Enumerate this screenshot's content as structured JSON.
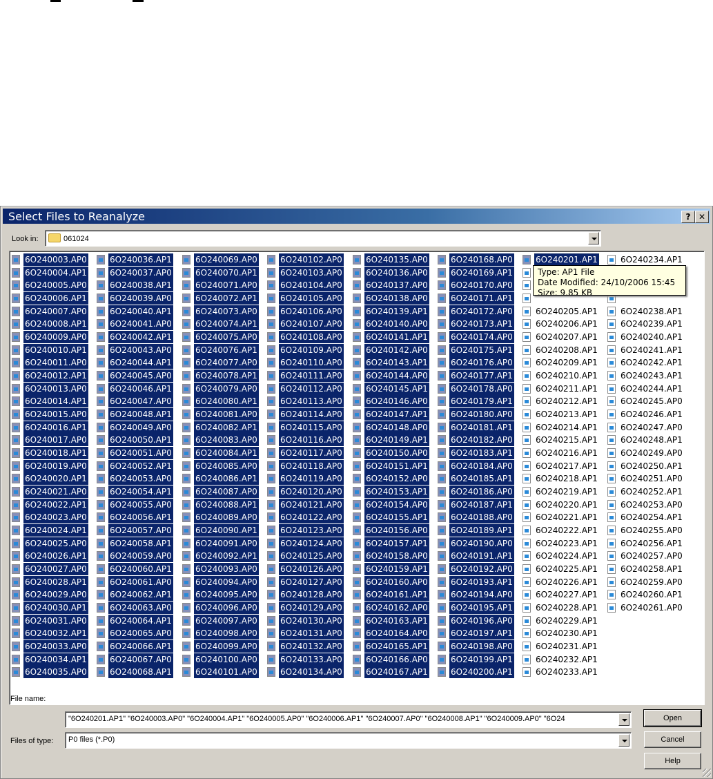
{
  "dialog": {
    "title": "Select Files to Reanalyze",
    "help_button": "?",
    "close_button": "✕",
    "look_in_label": "Look in:",
    "look_in_value": "061024",
    "file_name_label": "File name:",
    "file_name_value": "\"6O240201.AP1\" \"6O240003.AP0\" \"6O240004.AP1\" \"6O240005.AP0\" \"6O240006.AP1\" \"6O240007.AP0\" \"6O240008.AP1\" \"6O240009.AP0\" \"6O24",
    "files_of_type_label": "Files of type:",
    "files_of_type_value": "P0 files   (*.P0)",
    "open_button": "Open",
    "cancel_button": "Cancel",
    "help_text_button": "Help"
  },
  "tooltip": {
    "type": "Type: AP1 File",
    "modified": "Date Modified: 24/10/2006 15:45",
    "size": "Size: 9.85 KB"
  },
  "file_list": {
    "focused": "6O240201.AP1",
    "selected_columns": [
      0,
      1,
      2,
      3,
      4,
      5
    ],
    "columns": [
      [
        "6O240003.AP0",
        "6O240004.AP1",
        "6O240005.AP0",
        "6O240006.AP1",
        "6O240007.AP0",
        "6O240008.AP1",
        "6O240009.AP0",
        "6O240010.AP1",
        "6O240011.AP0",
        "6O240012.AP1",
        "6O240013.AP0",
        "6O240014.AP1",
        "6O240015.AP0",
        "6O240016.AP1",
        "6O240017.AP0",
        "6O240018.AP1",
        "6O240019.AP0",
        "6O240020.AP1",
        "6O240021.AP0",
        "6O240022.AP1",
        "6O240023.AP0",
        "6O240024.AP1",
        "6O240025.AP0",
        "6O240026.AP1",
        "6O240027.AP0",
        "6O240028.AP1",
        "6O240029.AP0",
        "6O240030.AP1",
        "6O240031.AP0",
        "6O240032.AP1",
        "6O240033.AP0",
        "6O240034.AP1",
        "6O240035.AP0"
      ],
      [
        "6O240036.AP1",
        "6O240037.AP0",
        "6O240038.AP1",
        "6O240039.AP0",
        "6O240040.AP1",
        "6O240041.AP0",
        "6O240042.AP1",
        "6O240043.AP0",
        "6O240044.AP1",
        "6O240045.AP0",
        "6O240046.AP1",
        "6O240047.AP0",
        "6O240048.AP1",
        "6O240049.AP0",
        "6O240050.AP1",
        "6O240051.AP0",
        "6O240052.AP1",
        "6O240053.AP0",
        "6O240054.AP1",
        "6O240055.AP0",
        "6O240056.AP1",
        "6O240057.AP0",
        "6O240058.AP1",
        "6O240059.AP0",
        "6O240060.AP1",
        "6O240061.AP0",
        "6O240062.AP1",
        "6O240063.AP0",
        "6O240064.AP1",
        "6O240065.AP0",
        "6O240066.AP1",
        "6O240067.AP0",
        "6O240068.AP1"
      ],
      [
        "6O240069.AP0",
        "6O240070.AP1",
        "6O240071.AP0",
        "6O240072.AP1",
        "6O240073.AP0",
        "6O240074.AP1",
        "6O240075.AP0",
        "6O240076.AP1",
        "6O240077.AP0",
        "6O240078.AP1",
        "6O240079.AP0",
        "6O240080.AP1",
        "6O240081.AP0",
        "6O240082.AP1",
        "6O240083.AP0",
        "6O240084.AP1",
        "6O240085.AP0",
        "6O240086.AP1",
        "6O240087.AP0",
        "6O240088.AP1",
        "6O240089.AP0",
        "6O240090.AP1",
        "6O240091.AP0",
        "6O240092.AP1",
        "6O240093.AP0",
        "6O240094.AP0",
        "6O240095.AP0",
        "6O240096.AP0",
        "6O240097.AP0",
        "6O240098.AP0",
        "6O240099.AP0",
        "6O240100.AP0",
        "6O240101.AP0"
      ],
      [
        "6O240102.AP0",
        "6O240103.AP0",
        "6O240104.AP0",
        "6O240105.AP0",
        "6O240106.AP0",
        "6O240107.AP0",
        "6O240108.AP0",
        "6O240109.AP0",
        "6O240110.AP0",
        "6O240111.AP0",
        "6O240112.AP0",
        "6O240113.AP0",
        "6O240114.AP0",
        "6O240115.AP0",
        "6O240116.AP0",
        "6O240117.AP0",
        "6O240118.AP0",
        "6O240119.AP0",
        "6O240120.AP0",
        "6O240121.AP0",
        "6O240122.AP0",
        "6O240123.AP0",
        "6O240124.AP0",
        "6O240125.AP0",
        "6O240126.AP0",
        "6O240127.AP0",
        "6O240128.AP0",
        "6O240129.AP0",
        "6O240130.AP0",
        "6O240131.AP0",
        "6O240132.AP0",
        "6O240133.AP0",
        "6O240134.AP0"
      ],
      [
        "6O240135.AP0",
        "6O240136.AP0",
        "6O240137.AP0",
        "6O240138.AP0",
        "6O240139.AP1",
        "6O240140.AP0",
        "6O240141.AP1",
        "6O240142.AP0",
        "6O240143.AP1",
        "6O240144.AP0",
        "6O240145.AP1",
        "6O240146.AP0",
        "6O240147.AP1",
        "6O240148.AP0",
        "6O240149.AP1",
        "6O240150.AP0",
        "6O240151.AP1",
        "6O240152.AP0",
        "6O240153.AP1",
        "6O240154.AP0",
        "6O240155.AP1",
        "6O240156.AP0",
        "6O240157.AP1",
        "6O240158.AP0",
        "6O240159.AP1",
        "6O240160.AP0",
        "6O240161.AP1",
        "6O240162.AP0",
        "6O240163.AP1",
        "6O240164.AP0",
        "6O240165.AP1",
        "6O240166.AP0",
        "6O240167.AP1"
      ],
      [
        "6O240168.AP0",
        "6O240169.AP1",
        "6O240170.AP0",
        "6O240171.AP1",
        "6O240172.AP0",
        "6O240173.AP1",
        "6O240174.AP0",
        "6O240175.AP1",
        "6O240176.AP0",
        "6O240177.AP1",
        "6O240178.AP0",
        "6O240179.AP1",
        "6O240180.AP0",
        "6O240181.AP1",
        "6O240182.AP0",
        "6O240183.AP1",
        "6O240184.AP0",
        "6O240185.AP1",
        "6O240186.AP0",
        "6O240187.AP1",
        "6O240188.AP0",
        "6O240189.AP1",
        "6O240190.AP0",
        "6O240191.AP1",
        "6O240192.AP0",
        "6O240193.AP1",
        "6O240194.AP0",
        "6O240195.AP1",
        "6O240196.AP0",
        "6O240197.AP1",
        "6O240198.AP0",
        "6O240199.AP1",
        "6O240200.AP1"
      ],
      [
        "6O240201.AP1",
        "",
        "",
        "",
        "6O240205.AP1",
        "6O240206.AP1",
        "6O240207.AP1",
        "6O240208.AP1",
        "6O240209.AP1",
        "6O240210.AP1",
        "6O240211.AP1",
        "6O240212.AP1",
        "6O240213.AP1",
        "6O240214.AP1",
        "6O240215.AP1",
        "6O240216.AP1",
        "6O240217.AP1",
        "6O240218.AP1",
        "6O240219.AP1",
        "6O240220.AP1",
        "6O240221.AP1",
        "6O240222.AP1",
        "6O240223.AP1",
        "6O240224.AP1",
        "6O240225.AP1",
        "6O240226.AP1",
        "6O240227.AP1",
        "6O240228.AP1",
        "6O240229.AP1",
        "6O240230.AP1",
        "6O240231.AP1",
        "6O240232.AP1",
        "6O240233.AP1"
      ],
      [
        "6O240234.AP1",
        "",
        "",
        "",
        "6O240238.AP1",
        "6O240239.AP1",
        "6O240240.AP1",
        "6O240241.AP1",
        "6O240242.AP1",
        "6O240243.AP1",
        "6O240244.AP1",
        "6O240245.AP0",
        "6O240246.AP1",
        "6O240247.AP0",
        "6O240248.AP1",
        "6O240249.AP0",
        "6O240250.AP1",
        "6O240251.AP0",
        "6O240252.AP1",
        "6O240253.AP0",
        "6O240254.AP1",
        "6O240255.AP0",
        "6O240256.AP1",
        "6O240257.AP0",
        "6O240258.AP1",
        "6O240259.AP0",
        "6O240260.AP1",
        "6O240261.AP0"
      ]
    ]
  }
}
